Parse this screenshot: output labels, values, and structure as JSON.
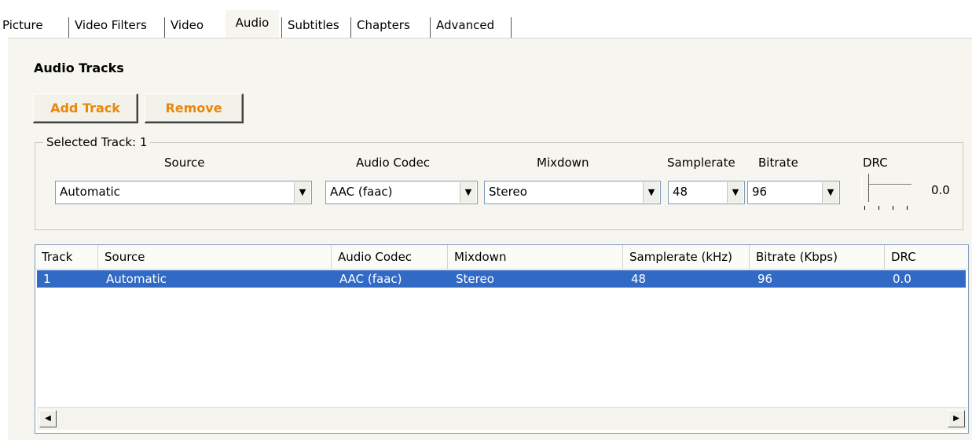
{
  "tabs": [
    "Picture",
    "Video Filters",
    "Video",
    "Audio",
    "Subtitles",
    "Chapters",
    "Advanced"
  ],
  "active_tab": "Audio",
  "section_title": "Audio Tracks",
  "buttons": {
    "add": "Add Track",
    "remove": "Remove"
  },
  "selected_track": {
    "legend": "Selected Track: 1",
    "labels": {
      "source": "Source",
      "codec": "Audio Codec",
      "mixdown": "Mixdown",
      "samplerate": "Samplerate",
      "bitrate": "Bitrate",
      "drc": "DRC"
    },
    "values": {
      "source": "Automatic",
      "codec": "AAC (faac)",
      "mixdown": "Stereo",
      "samplerate": "48",
      "bitrate": "96",
      "drc": "0.0"
    }
  },
  "table": {
    "columns": [
      "Track",
      "Source",
      "Audio Codec",
      "Mixdown",
      "Samplerate (kHz)",
      "Bitrate (Kbps)",
      "DRC"
    ],
    "rows": [
      [
        "1",
        "Automatic",
        "AAC (faac)",
        "Stereo",
        "48",
        "96",
        "0.0"
      ]
    ],
    "selected_row": 0
  },
  "colors": {
    "accent": "#e8870c",
    "selection": "#316ac5",
    "panel": "#f6f5ef"
  }
}
